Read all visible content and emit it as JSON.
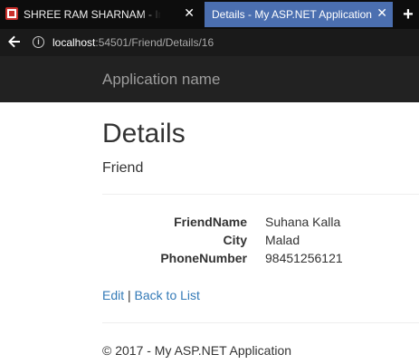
{
  "browser": {
    "tabs": [
      {
        "title": "SHREE RAM SHARNAM - Inte",
        "active": false,
        "favicon": "red-square-icon"
      },
      {
        "title": "Details - My ASP.NET Application",
        "active": true
      }
    ],
    "tab_close_glyph": "✕",
    "new_tab_glyph": "+",
    "back_glyph": "🡐",
    "info_glyph": "i",
    "url_host": "localhost",
    "url_rest": ":54501/Friend/Details/16"
  },
  "navbar": {
    "brand": "Application name"
  },
  "page": {
    "title": "Details",
    "subtitle": "Friend",
    "fields": [
      {
        "label": "FriendName",
        "value": "Suhana Kalla"
      },
      {
        "label": "City",
        "value": "Malad"
      },
      {
        "label": "PhoneNumber",
        "value": "98451256121"
      }
    ],
    "links": {
      "edit": "Edit",
      "separator": " | ",
      "back": "Back to List"
    },
    "footer": "© 2017 - My ASP.NET Application"
  },
  "colors": {
    "tabstrip": "#0d0d0d",
    "active_tab": "#4b6fb0",
    "navbar": "#222222",
    "brand_text": "#9d9d9d",
    "link": "#337ab7"
  }
}
